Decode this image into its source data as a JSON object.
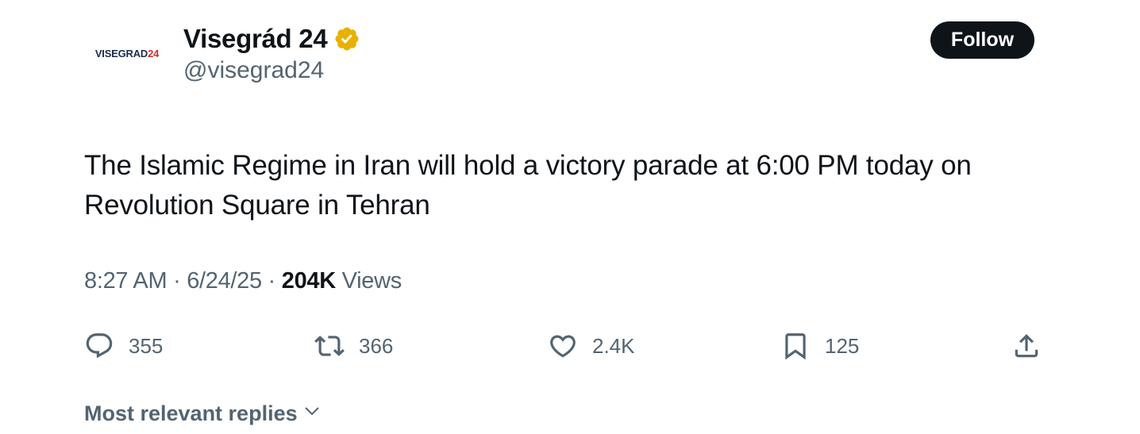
{
  "author": {
    "avatar_logo_primary": "VISEGRAD",
    "avatar_logo_accent": "24",
    "display_name": "Visegrád 24",
    "handle": "@visegrad24",
    "verified_icon": "verified-badge-gold",
    "verified_color": "#e8b100"
  },
  "follow_button": {
    "label": "Follow"
  },
  "tweet": {
    "text": "The Islamic Regime in Iran will hold a victory parade at 6:00 PM today on Revolution Square in Tehran"
  },
  "meta": {
    "time": "8:27 AM",
    "separator": " · ",
    "date": "6/24/25",
    "views_count": "204K",
    "views_label": " Views"
  },
  "actions": {
    "reply": {
      "icon": "reply-icon",
      "count": "355"
    },
    "retweet": {
      "icon": "retweet-icon",
      "count": "366"
    },
    "like": {
      "icon": "heart-icon",
      "count": "2.4K"
    },
    "bookmark": {
      "icon": "bookmark-icon",
      "count": "125"
    },
    "share": {
      "icon": "share-icon"
    }
  },
  "replies_sort": {
    "label": "Most relevant replies",
    "icon": "chevron-down-icon"
  },
  "colors": {
    "text_primary": "#0f1419",
    "text_secondary": "#536471",
    "button_bg": "#0f1419",
    "logo_navy": "#1b2a4e",
    "logo_red": "#d52b2b"
  }
}
